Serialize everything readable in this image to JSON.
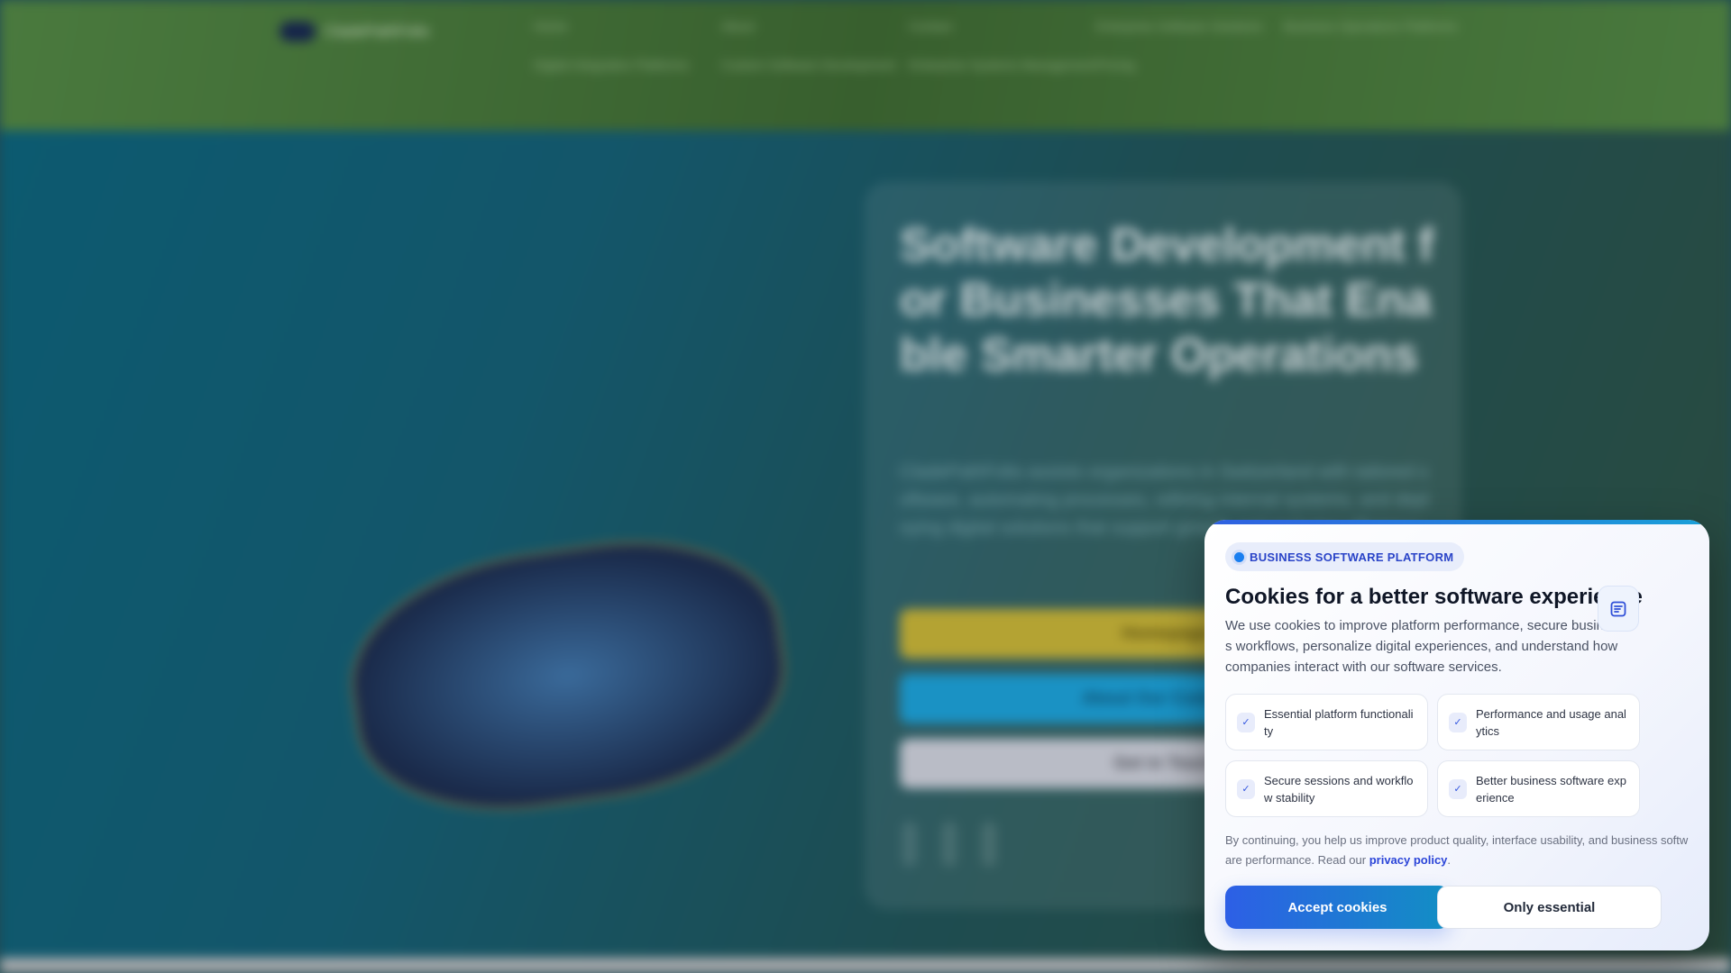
{
  "header": {
    "logo": "CladePathFolio",
    "nav": [
      "Home",
      "About",
      "Contact",
      "Enterprise Software Solutions",
      "Business Operations Platforms",
      "Digital Integration Platforms",
      "Custom Software Development",
      "Enterprise Systems Management",
      "Pricing"
    ]
  },
  "hero": {
    "title": "Software Development for Businesses That Enable Smarter Operations",
    "text": "CladePathFolio assists organizations in Switzerland with tailored software, automating processes, refining internal systems, and deploying digital solutions that support growth and enduring efficiency.",
    "buttons": [
      "Homepage",
      "About Our Company",
      "Get in Touch"
    ]
  },
  "cookie": {
    "badge": "BUSINESS SOFTWARE PLATFORM",
    "title": "Cookies for a better software experience",
    "body": "We use cookies to improve platform performance, secure business workflows, personalize digital experiences, and understand how companies interact with our software services.",
    "features": [
      "Essential platform functionality",
      "Performance and usage analytics",
      "Secure sessions and workflow stability",
      "Better business software experience"
    ],
    "footer_text": "By continuing, you help us improve product quality, interface usability, and business software performance. Read our ",
    "privacy_link": "privacy policy",
    "footer_end": ".",
    "accept": "Accept cookies",
    "essential": "Only essential"
  }
}
